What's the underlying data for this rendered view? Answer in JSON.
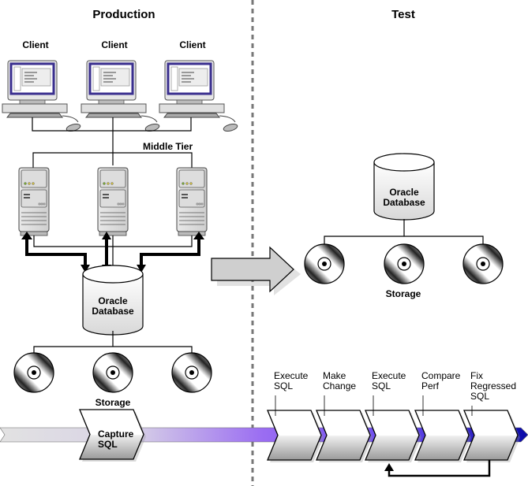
{
  "diagram": {
    "sections": {
      "production": "Production",
      "test": "Test"
    },
    "production": {
      "clients": [
        {
          "label": "Client"
        },
        {
          "label": "Client"
        },
        {
          "label": "Client"
        }
      ],
      "middle_tier_label": "Middle Tier",
      "app_servers": 3,
      "database": {
        "line1": "Oracle",
        "line2": "Database"
      },
      "storage_label": "Storage",
      "storage_disks": 3
    },
    "test": {
      "database": {
        "line1": "Oracle",
        "line2": "Database"
      },
      "storage_label": "Storage",
      "storage_disks": 3
    },
    "transfer_arrow": "production-to-test",
    "process": {
      "capture_step": "Capture\nSQL",
      "steps": [
        {
          "label": "Execute\nSQL"
        },
        {
          "label": "Make\nChange"
        },
        {
          "label": "Execute\nSQL"
        },
        {
          "label": "Compare\nPerf"
        },
        {
          "label": "Fix\nRegressed\nSQL"
        }
      ],
      "feedback_loop": {
        "from_step": 5,
        "to_step": 3
      }
    },
    "colors": {
      "monitor_screen_border": "#3a2f8f",
      "process_bar_start": "#e2e2e2",
      "process_bar_mid": "#9a6cf2",
      "process_bar_end": "#0a0aa8",
      "arrow_fill": "#cfcfcf",
      "divider": "#777777"
    }
  }
}
